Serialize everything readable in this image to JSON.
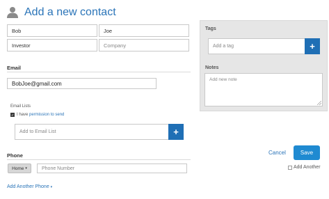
{
  "header": {
    "title": "Add a new contact"
  },
  "name_fields": {
    "first_name_value": "Bob",
    "last_name_value": "Joe",
    "title_value": "Investor",
    "company_placeholder": "Company"
  },
  "email": {
    "section_label": "Email",
    "value": "BobJoe@gmail.com",
    "lists_label": "Email Lists",
    "permission_prefix": "I have",
    "permission_link": "permission to send",
    "permission_checked": true,
    "add_list_label": "Add to Email List",
    "add_icon": "plus-icon"
  },
  "phone": {
    "section_label": "Phone",
    "type_label": "Home",
    "type_caret": "▾",
    "number_placeholder": "Phone Number",
    "add_another_label": "Add Another Phone",
    "add_another_caret": "▾"
  },
  "tags": {
    "label": "Tags",
    "placeholder": "Add a tag",
    "add_icon": "plus-icon"
  },
  "notes": {
    "label": "Notes",
    "placeholder": "Add new note"
  },
  "actions": {
    "cancel_label": "Cancel",
    "save_label": "Save",
    "add_another_label": "Add Another",
    "add_another_checked": false
  },
  "colors": {
    "accent": "#1f6fb5",
    "link": "#2a74b8",
    "save": "#1f8ad1",
    "panel": "#e6e6e6"
  }
}
